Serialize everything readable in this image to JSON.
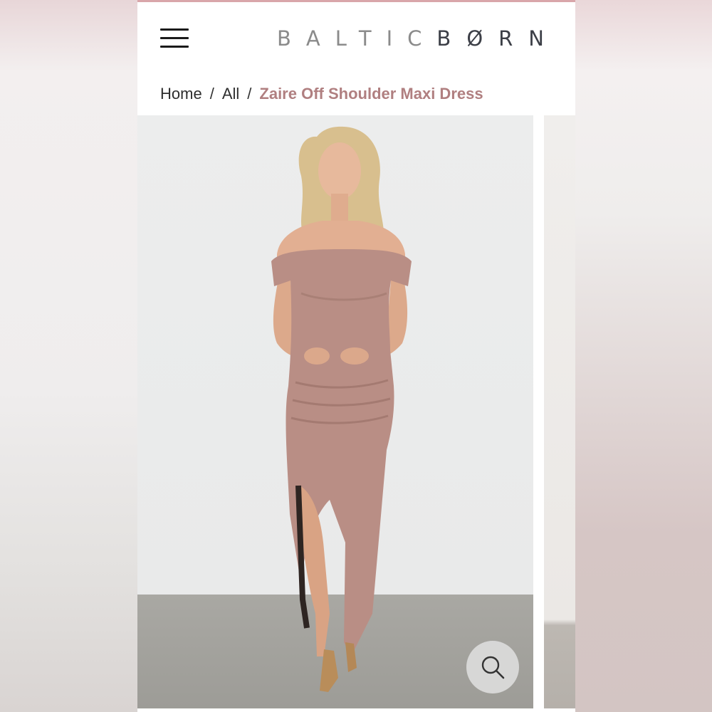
{
  "header": {
    "menu_icon": "hamburger-menu-icon",
    "logo_light": "BALTIC",
    "logo_dark": "BØRN"
  },
  "breadcrumb": {
    "items": [
      "Home",
      "All"
    ],
    "separator": "/",
    "current": "Zaire Off Shoulder Maxi Dress"
  },
  "gallery": {
    "zoom_icon": "magnifier-icon",
    "dress_color": "#b98e85"
  },
  "colors": {
    "accent": "#b07f80",
    "top_rule": "#d9a6aa",
    "logo_dark": "#3c3f47"
  }
}
